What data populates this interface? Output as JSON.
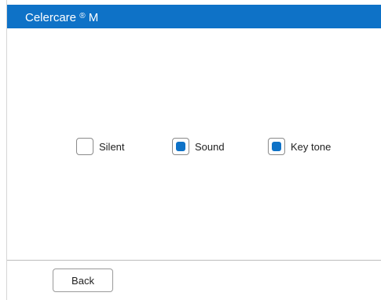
{
  "app": {
    "title": "Celercare",
    "title_mark": "®",
    "title_suffix": "M"
  },
  "sound_mode": {
    "options": [
      {
        "label": "Silent",
        "checked": false
      },
      {
        "label": "Sound",
        "checked": true
      },
      {
        "label": "Key tone",
        "checked": true
      }
    ]
  },
  "footer": {
    "back_label": "Back"
  },
  "colors": {
    "accent": "#0e72c7",
    "title_text": "#ffffff"
  }
}
